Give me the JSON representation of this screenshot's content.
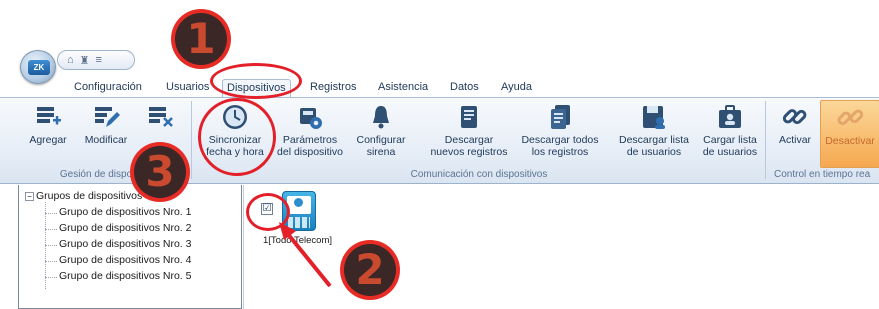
{
  "quick_access": {
    "icons": [
      "home-icon",
      "people-icon",
      "menu-icon"
    ],
    "glyphs": [
      "⌂",
      "♜",
      "≡"
    ]
  },
  "tabs": [
    {
      "label": "Configuración",
      "active": false
    },
    {
      "label": "Usuarios",
      "active": false
    },
    {
      "label": "Dispositivos",
      "active": true
    },
    {
      "label": "Registros",
      "active": false
    },
    {
      "label": "Asistencia",
      "active": false
    },
    {
      "label": "Datos",
      "active": false
    },
    {
      "label": "Ayuda",
      "active": false
    }
  ],
  "ribbon": {
    "groups": [
      {
        "label": "Gesión de dispo",
        "buttons": [
          {
            "label": "Agregar",
            "icon": "add-device-icon"
          },
          {
            "label": "Modificar",
            "icon": "edit-icon"
          },
          {
            "label": "",
            "icon": "delete-device-icon"
          }
        ]
      },
      {
        "label": "Comunicación con dispositivos",
        "buttons": [
          {
            "label_line1": "Sincronizar",
            "label_line2": "fecha y hora",
            "icon": "clock-icon"
          },
          {
            "label_line1": "Parámetros",
            "label_line2": "del dispositivo",
            "icon": "settings-icon"
          },
          {
            "label_line1": "Configurar",
            "label_line2": "sirena",
            "icon": "bell-icon"
          },
          {
            "label_line1": "Descargar",
            "label_line2": "nuevos registros",
            "icon": "download-records-icon"
          },
          {
            "label_line1": "Descargar todos",
            "label_line2": "los registros",
            "icon": "download-all-icon"
          },
          {
            "label_line1": "Descargar lista",
            "label_line2": "de usuarios",
            "icon": "download-users-icon"
          },
          {
            "label_line1": "Cargar lista",
            "label_line2": "de usuarios",
            "icon": "upload-users-icon"
          }
        ]
      },
      {
        "label": "Control en tiempo rea",
        "buttons": [
          {
            "label": "Activar",
            "icon": "link-icon"
          },
          {
            "label": "Desactivar",
            "icon": "unlink-icon"
          }
        ]
      }
    ]
  },
  "tree": {
    "root": "Grupos de dispositivos",
    "items": [
      "Grupo de dispositivos Nro. 1",
      "Grupo de dispositivos Nro. 2",
      "Grupo de dispositivos Nro. 3",
      "Grupo de dispositivos Nro. 4",
      "Grupo de dispositivos Nro. 5"
    ]
  },
  "device": {
    "label": "1[Todo Telecom]",
    "checked": true,
    "check_glyph": "☑"
  },
  "annotations": [
    {
      "number": "1"
    },
    {
      "number": "2"
    },
    {
      "number": "3"
    }
  ],
  "colors": {
    "annotation_red": "#e3202a",
    "badge_dark": "#3a2726",
    "highlight_orange": "#f6a84f"
  }
}
